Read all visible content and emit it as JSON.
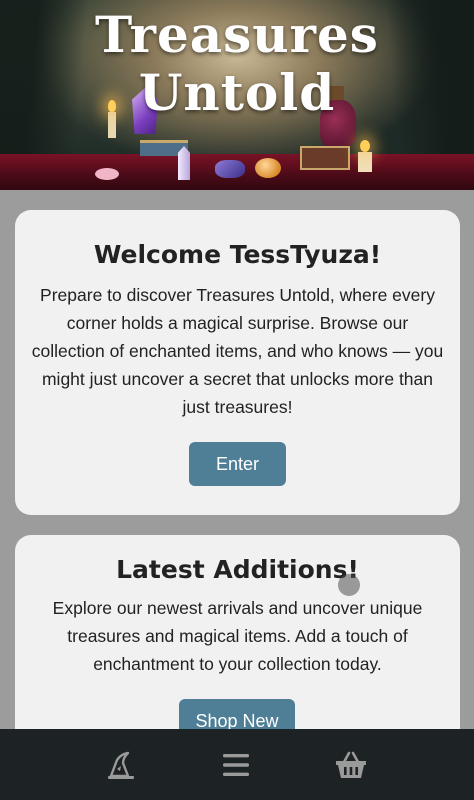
{
  "hero": {
    "title_line1": "Treasures",
    "title_line2": "Untold"
  },
  "welcome": {
    "heading": "Welcome TessTyuza!",
    "body": "Prepare to discover Treasures Untold, where every corner holds a magical surprise. Browse our collection of enchanted items, and who knows — you might just uncover a secret that unlocks more than just treasures!",
    "button_label": "Enter"
  },
  "latest": {
    "heading": "Latest Additions!",
    "body": "Explore our newest arrivals and uncover unique treasures and magical items. Add a touch of enchantment to your collection today.",
    "button_label": "Shop New"
  },
  "bottom_nav": {
    "items": [
      {
        "icon": "wizard-hat-icon"
      },
      {
        "icon": "hamburger-menu-icon"
      },
      {
        "icon": "basket-icon"
      }
    ]
  },
  "colors": {
    "button": "#4f7f96",
    "nav_background": "#1d2224",
    "card_background": "#f1f1f1",
    "page_background": "#9c9c9c"
  }
}
